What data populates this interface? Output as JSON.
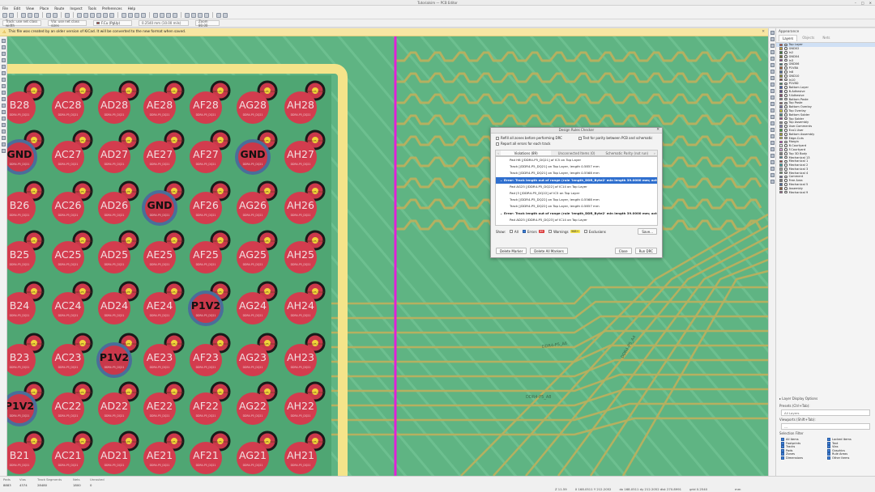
{
  "window": {
    "title": "Tutorialsim — PCB Editor"
  },
  "menu": [
    "File",
    "Edit",
    "View",
    "Place",
    "Route",
    "Inspect",
    "Tools",
    "Preferences",
    "Help"
  ],
  "options_bar": {
    "track": "Track: use net class width",
    "via": "Via: use net class sizes",
    "layer": "F.Cu (PgUp)",
    "grid": "0.2540 mm (10.00 mils)",
    "zoom": "Zoom 80.00"
  },
  "infobar": {
    "message": "This file was created by an older version of KiCad. It will be converted to the new format when saved."
  },
  "pads": {
    "rows": [
      {
        "cells": [
          "B28",
          "AC28",
          "AD28",
          "AE28",
          "AF28",
          "AG28",
          "AH28"
        ]
      },
      {
        "cells": [
          "GND",
          "AC27",
          "AD27",
          "AE27",
          "AF27",
          "GND",
          "AH27"
        ]
      },
      {
        "cells": [
          "B26",
          "AC26",
          "AD26",
          "GND",
          "AF26",
          "AG26",
          "AH26"
        ]
      },
      {
        "cells": [
          "B25",
          "AC25",
          "AD25",
          "AE25",
          "AF25",
          "AG25",
          "AH25"
        ]
      },
      {
        "cells": [
          "B24",
          "AC24",
          "AD24",
          "AE24",
          "P1V2",
          "AG24",
          "AH24"
        ]
      },
      {
        "cells": [
          "B23",
          "AC23",
          "P1V2",
          "AE23",
          "AF23",
          "AG23",
          "AH23"
        ]
      },
      {
        "cells": [
          "P1V2",
          "AC22",
          "AD22",
          "AE22",
          "AF22",
          "AG22",
          "AH22"
        ]
      },
      {
        "cells": [
          "B21",
          "AC21",
          "AD21",
          "AE21",
          "AF21",
          "AG21",
          "AH21"
        ]
      }
    ],
    "sublabels": [
      "DDR4-P5_DQ21",
      "GND",
      "P1V2",
      "x"
    ]
  },
  "trace_labels": [
    "DDR4-P5_A6",
    "DDR4-P5_A8",
    "DDR4-P5_A4"
  ],
  "appearance": {
    "title": "Appearance",
    "tabs": [
      "Layers",
      "Objects",
      "Nets"
    ],
    "layers": [
      {
        "name": "Top Layer",
        "color": "#c83434"
      },
      {
        "name": "GND02",
        "color": "#c8a030"
      },
      {
        "name": "In2",
        "color": "#3a7a3a"
      },
      {
        "name": "GND04",
        "color": "#6e6e30"
      },
      {
        "name": "In3",
        "color": "#8a3a8a"
      },
      {
        "name": "GND06",
        "color": "#307a7a"
      },
      {
        "name": "P1V8A",
        "color": "#a06030"
      },
      {
        "name": "In8",
        "color": "#4a6a9a"
      },
      {
        "name": "GND10",
        "color": "#8a8a30"
      },
      {
        "name": "In10",
        "color": "#6a3a3a"
      },
      {
        "name": "P1V8D",
        "color": "#3a8a5a"
      },
      {
        "name": "Bottom Layer",
        "color": "#3a5ab0"
      },
      {
        "name": "B.Adhesive",
        "color": "#5a4a8a"
      },
      {
        "name": "F.Adhesive",
        "color": "#8a4a6a"
      },
      {
        "name": "Bottom Paste",
        "color": "#6a8a9a"
      },
      {
        "name": "Top Paste",
        "color": "#9a6a6a"
      },
      {
        "name": "Bottom Overlay",
        "color": "#6a6aa0"
      },
      {
        "name": "Top Overlay",
        "color": "#d0c830"
      },
      {
        "name": "Bottom Solder",
        "color": "#4a8a8a"
      },
      {
        "name": "Top Solder",
        "color": "#9a3a9a"
      },
      {
        "name": "Top Assembly",
        "color": "#8a8a8a"
      },
      {
        "name": "User.Comments",
        "color": "#7a7ab0"
      },
      {
        "name": "Eco1.User",
        "color": "#3aa03a"
      },
      {
        "name": "Bottom Assembly",
        "color": "#a0a03a"
      },
      {
        "name": "Edge.Cuts",
        "color": "#d0d030"
      },
      {
        "name": "Margin",
        "color": "#d030d0"
      },
      {
        "name": "B.Courtyard",
        "color": "#e0e0e0"
      },
      {
        "name": "F.Courtyard",
        "color": "#e0a0e0"
      },
      {
        "name": "Top 3D Body",
        "color": "#808080"
      },
      {
        "name": "Mechanical 13",
        "color": "#3a8aa0"
      },
      {
        "name": "Mechanical 1",
        "color": "#a03a3a"
      },
      {
        "name": "Mechanical 2",
        "color": "#3aa0a0"
      },
      {
        "name": "Mechanical 3",
        "color": "#a0a0a0"
      },
      {
        "name": "Mechanical 4",
        "color": "#6a9a6a"
      },
      {
        "name": "Comment",
        "color": "#5a5aa0"
      },
      {
        "name": "Free Area",
        "color": "#7a7a7a"
      },
      {
        "name": "Mechanical 5",
        "color": "#4a6aa0"
      },
      {
        "name": "Assembly",
        "color": "#8a5a3a"
      },
      {
        "name": "Mechanical 9",
        "color": "#a05a8a"
      }
    ],
    "layer_options": "Layer Display Options",
    "presets_label": "Presets (Ctrl+Tab):",
    "presets_value": "All Layers",
    "viewports_label": "Viewports (Shift+Tab):",
    "viewports_value": "---",
    "filter_title": "Selection Filter",
    "filters": [
      "All items",
      "Locked items",
      "Footprints",
      "Text",
      "Tracks",
      "Vias",
      "Pads",
      "Graphics",
      "Zones",
      "Rule Areas",
      "Dimensions",
      "Other items"
    ]
  },
  "status": {
    "pads": {
      "label": "Pads",
      "value": "8883"
    },
    "vias": {
      "label": "Vias",
      "value": "4374"
    },
    "segments": {
      "label": "Track Segments",
      "value": "28480"
    },
    "nets": {
      "label": "Nets",
      "value": "1800"
    },
    "unrouted": {
      "label": "Unrouted",
      "value": "0"
    },
    "z": "Z 11.59",
    "xy": "X 168.0511  Y 212.2052",
    "dxdy": "dx 168.0511  dy 212.2052  dist 270.8991",
    "grid": "grid 0.2540",
    "units": "mm"
  },
  "drc": {
    "title": "Design Rules Checker",
    "opt_refill": "Refill all zones before performing DRC",
    "opt_parity": "Test for parity between PCB and schematic",
    "opt_report": "Report all errors for each track",
    "tabs": [
      "Violations (89)",
      "Unconnected Items (0)",
      "Schematic Parity (not run)"
    ],
    "rows": [
      {
        "text": "Pad H8 [/DDR4-P5_DQ21] of IC5 on Top Layer",
        "type": "item"
      },
      {
        "text": "Track [/DDR4-P5_DQ21] on Top Layer, length 0.5857 mm",
        "type": "item"
      },
      {
        "text": "Track [/DDR4-P5_DQ21] on Top Layer, length 0.5568 mm",
        "type": "item"
      },
      {
        "text": "Error: Track length out of range (rule 'length_DDR_Byte2' min length 39.0000 mm; actu",
        "type": "err-sel"
      },
      {
        "text": "Pad AG25 [/DDR4-P5_DQ22] of IC14 on Top Layer",
        "type": "item"
      },
      {
        "text": "Pad J3 [/DDR4-P5_DQ22] of IC5 on Top Layer",
        "type": "item"
      },
      {
        "text": "Track [/DDR4-P5_DQ22] on Top Layer, length 0.5568 mm",
        "type": "item"
      },
      {
        "text": "Track [/DDR4-P5_DQ22] on Top Layer, length 0.5857 mm",
        "type": "item"
      },
      {
        "text": "Error: Track length out of range (rule 'length_DDR_Byte2' min length 39.0000 mm; actu",
        "type": "err"
      },
      {
        "text": "Pad AD25 [/DDR4-P5_DQ23] of IC14 on Top Layer",
        "type": "item"
      }
    ],
    "show_label": "Show:",
    "show_all": "All",
    "show_errors": "Errors",
    "errors_count": "89",
    "show_warnings": "Warnings",
    "warnings_count": "968+",
    "show_exclusions": "Exclusions",
    "save_btn": "Save...",
    "delete_marker": "Delete Marker",
    "delete_all": "Delete All Markers",
    "close_btn": "Close",
    "run_btn": "Run DRC"
  }
}
